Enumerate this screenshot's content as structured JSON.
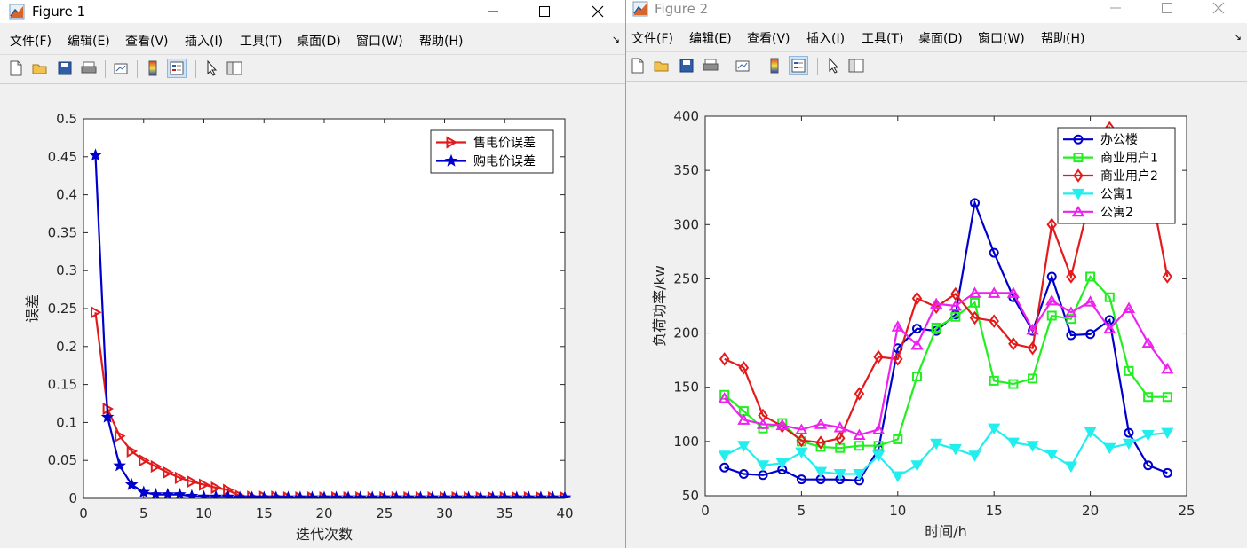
{
  "windows": [
    {
      "title": "Figure 1",
      "menu": [
        "文件(F)",
        "编辑(E)",
        "查看(V)",
        "插入(I)",
        "工具(T)",
        "桌面(D)",
        "窗口(W)",
        "帮助(H)"
      ]
    },
    {
      "title": "Figure 2",
      "menu": [
        "文件(F)",
        "编辑(E)",
        "查看(V)",
        "插入(I)",
        "工具(T)",
        "桌面(D)",
        "窗口(W)",
        "帮助(H)"
      ]
    }
  ],
  "toolbar_icons": [
    "new-figure-icon",
    "open-file-icon",
    "save-icon",
    "print-icon",
    "link-plot-icon",
    "colorbar-icon",
    "legend-icon",
    "pointer-icon",
    "property-editor-icon"
  ],
  "chart_data": [
    {
      "type": "line",
      "title": "",
      "xlabel": "迭代次数",
      "ylabel": "误差",
      "xlim": [
        0,
        40
      ],
      "ylim": [
        0,
        0.5
      ],
      "xticks": [
        "0",
        "5",
        "10",
        "15",
        "20",
        "25",
        "30",
        "35",
        "40"
      ],
      "yticks": [
        "0",
        "0.05",
        "0.1",
        "0.15",
        "0.2",
        "0.25",
        "0.3",
        "0.35",
        "0.4",
        "0.45",
        "0.5"
      ],
      "grid": false,
      "legend_position": "top-right",
      "x": [
        1,
        2,
        3,
        4,
        5,
        6,
        7,
        8,
        9,
        10,
        11,
        12,
        13,
        14,
        15,
        16,
        17,
        18,
        19,
        20,
        21,
        22,
        23,
        24,
        25,
        26,
        27,
        28,
        29,
        30,
        31,
        32,
        33,
        34,
        35,
        36,
        37,
        38,
        39,
        40
      ],
      "series": [
        {
          "name": "售电价误差",
          "color": "#e31a1c",
          "marker": "triangle-right",
          "values": [
            0.245,
            0.118,
            0.082,
            0.062,
            0.05,
            0.042,
            0.034,
            0.027,
            0.022,
            0.018,
            0.014,
            0.011,
            0.003,
            0.002,
            0.002,
            0.002,
            0.001,
            0.001,
            0.001,
            0.001,
            0.001,
            0.001,
            0.001,
            0.001,
            0.001,
            0.001,
            0.001,
            0.001,
            0.001,
            0.001,
            0.001,
            0.001,
            0.001,
            0.001,
            0.001,
            0.001,
            0.001,
            0.001,
            0.001,
            0.001
          ]
        },
        {
          "name": "购电价误差",
          "color": "#0000cc",
          "marker": "star",
          "values": [
            0.452,
            0.107,
            0.043,
            0.018,
            0.008,
            0.005,
            0.005,
            0.005,
            0.003,
            0.002,
            0.002,
            0.002,
            0.001,
            0.001,
            0.001,
            0.001,
            0.001,
            0.001,
            0.001,
            0.001,
            0.001,
            0.001,
            0.001,
            0.001,
            0.001,
            0.001,
            0.001,
            0.001,
            0.001,
            0.001,
            0.001,
            0.001,
            0.001,
            0.001,
            0.001,
            0.001,
            0.001,
            0.001,
            0.001,
            0.001
          ]
        }
      ]
    },
    {
      "type": "line",
      "title": "",
      "xlabel": "时间/h",
      "ylabel": "负荷功率/kw",
      "xlim": [
        0,
        25
      ],
      "ylim": [
        50,
        400
      ],
      "xticks": [
        "0",
        "5",
        "10",
        "15",
        "20",
        "25"
      ],
      "yticks": [
        "50",
        "100",
        "150",
        "200",
        "250",
        "300",
        "350",
        "400"
      ],
      "grid": false,
      "legend_position": "top-right",
      "x": [
        1,
        2,
        3,
        4,
        5,
        6,
        7,
        8,
        9,
        10,
        11,
        12,
        13,
        14,
        15,
        16,
        17,
        18,
        19,
        20,
        21,
        22,
        23,
        24
      ],
      "series": [
        {
          "name": "办公楼",
          "color": "#0000cc",
          "marker": "circle",
          "values": [
            76,
            70,
            69,
            74,
            65,
            65,
            65,
            64,
            93,
            186,
            204,
            202,
            217,
            320,
            274,
            233,
            202,
            252,
            198,
            199,
            212,
            108,
            78,
            71
          ]
        },
        {
          "name": "商业用户1",
          "color": "#22ee22",
          "marker": "square",
          "values": [
            143,
            128,
            112,
            117,
            100,
            95,
            94,
            96,
            96,
            102,
            160,
            205,
            215,
            228,
            156,
            153,
            158,
            216,
            213,
            252,
            233,
            165,
            141,
            141
          ]
        },
        {
          "name": "商业用户2",
          "color": "#e31a1c",
          "marker": "diamond",
          "values": [
            176,
            168,
            124,
            114,
            101,
            99,
            103,
            144,
            178,
            176,
            232,
            224,
            236,
            214,
            211,
            190,
            186,
            300,
            252,
            325,
            389,
            355,
            346,
            252
          ]
        },
        {
          "name": "公寓1",
          "color": "#22eeee",
          "marker": "triangle-down",
          "values": [
            87,
            96,
            78,
            80,
            90,
            72,
            70,
            70,
            87,
            68,
            78,
            98,
            93,
            87,
            112,
            99,
            96,
            88,
            77,
            109,
            94,
            98,
            106,
            108
          ]
        },
        {
          "name": "公寓2",
          "color": "#ee22ee",
          "marker": "triangle-up",
          "values": [
            140,
            120,
            116,
            115,
            111,
            116,
            113,
            106,
            111,
            206,
            189,
            227,
            225,
            237,
            237,
            237,
            203,
            230,
            219,
            229,
            204,
            223,
            191,
            167
          ]
        }
      ]
    }
  ]
}
